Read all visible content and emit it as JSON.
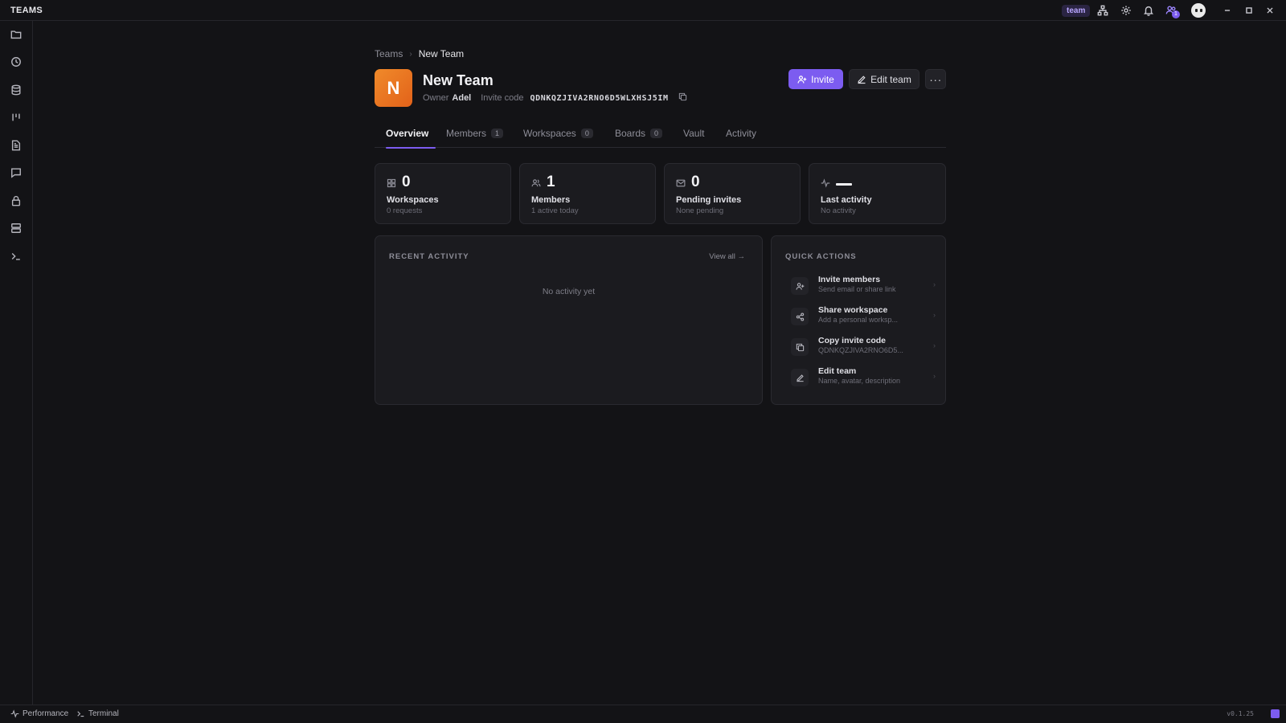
{
  "app": {
    "title": "TEAMS"
  },
  "titlebar": {
    "team_badge": "team",
    "notifications_count": "1"
  },
  "statusbar": {
    "performance": "Performance",
    "terminal": "Terminal",
    "version": "v0.1.25"
  },
  "breadcrumb": {
    "root": "Teams",
    "current": "New Team"
  },
  "team": {
    "avatar_letter": "N",
    "name": "New Team",
    "owner_label": "Owner",
    "owner_name": "Adel",
    "invite_code_label": "Invite code",
    "invite_code": "QDNKQZJIVA2RNO6D5WLXHSJ5IM"
  },
  "actions": {
    "invite": "Invite",
    "edit_team": "Edit team",
    "more": "···"
  },
  "tabs": [
    {
      "label": "Overview",
      "count": null
    },
    {
      "label": "Members",
      "count": "1"
    },
    {
      "label": "Workspaces",
      "count": "0"
    },
    {
      "label": "Boards",
      "count": "0"
    },
    {
      "label": "Vault",
      "count": null
    },
    {
      "label": "Activity",
      "count": null
    }
  ],
  "stats": [
    {
      "icon": "grid-icon",
      "value": "0",
      "label": "Workspaces",
      "sub": "0 requests"
    },
    {
      "icon": "users-icon",
      "value": "1",
      "label": "Members",
      "sub": "1 active today"
    },
    {
      "icon": "mail-icon",
      "value": "0",
      "label": "Pending invites",
      "sub": "None pending"
    },
    {
      "icon": "activity-icon",
      "value": "",
      "label": "Last activity",
      "sub": "No activity"
    }
  ],
  "recent_activity": {
    "title": "RECENT ACTIVITY",
    "view_all": "View all →",
    "empty": "No activity yet"
  },
  "quick_actions": {
    "title": "QUICK ACTIONS",
    "items": [
      {
        "icon": "user-plus-icon",
        "title": "Invite members",
        "sub": "Send email or share link"
      },
      {
        "icon": "share-icon",
        "title": "Share workspace",
        "sub": "Add a personal worksp..."
      },
      {
        "icon": "copy-icon",
        "title": "Copy invite code",
        "sub": "QDNKQZJIVA2RNO6D5..."
      },
      {
        "icon": "edit-icon",
        "title": "Edit team",
        "sub": "Name, avatar, description"
      }
    ]
  }
}
